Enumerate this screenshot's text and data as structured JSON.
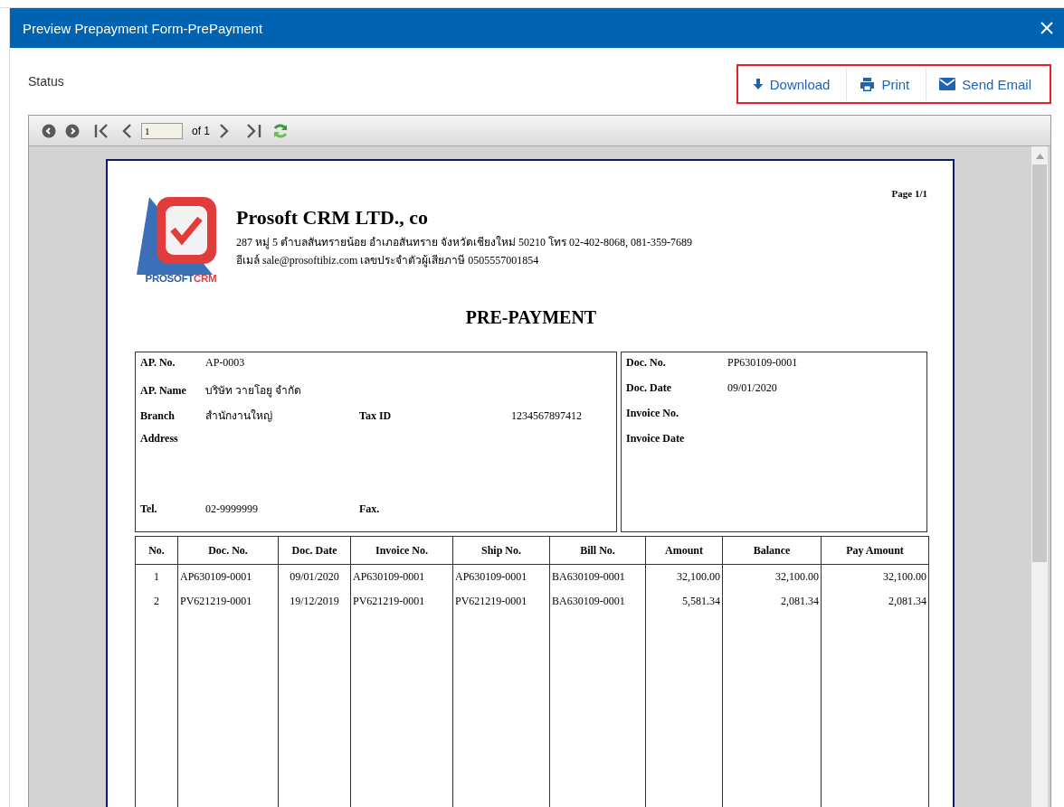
{
  "window": {
    "title": "Preview Prepayment Form-PrePayment"
  },
  "status_label": "Status",
  "actions_highlighted": true,
  "actions": [
    {
      "label": "Download",
      "kind": "download"
    },
    {
      "label": "Print",
      "kind": "print"
    },
    {
      "label": "Send Email",
      "kind": "email"
    }
  ],
  "toolbar": {
    "page_field": "1",
    "page_count": "of 1"
  },
  "report": {
    "page_label": "Page 1/1",
    "logo": {
      "text_1": "PROSOFT",
      "text_2": "CRM"
    },
    "company": "Prosoft CRM LTD., co",
    "address_lines": [
      "287 หมู่ 5 ตำบลสันทรายน้อย อำเภอสันทราย จังหวัดเชียงใหม่ 50210 โทร 02-402-8068, 081-359-7689",
      "อีเมล์ sale@prosoftibiz.com เลขประจำตัวผู้เสียภาษี 0505557001854"
    ],
    "title": "PRE-PAYMENT",
    "left_fields": [
      {
        "label": "AP. No.",
        "value": "AP-0003"
      },
      {
        "label": "AP. Name",
        "value": "บริษัท วายโอยู จำกัด"
      },
      {
        "label": "Branch",
        "value": "สำนักงานใหญ่",
        "label_2": "Tax ID",
        "value_2": "1234567897412"
      },
      {
        "label": "Address"
      },
      {
        "label": "Tel.",
        "value": "02-9999999",
        "label_2": "Fax."
      }
    ],
    "right_fields": [
      {
        "label": "Doc. No.",
        "value": "PP630109-0001"
      },
      {
        "label": "Doc. Date",
        "value": "09/01/2020"
      },
      {
        "label": "Invoice No."
      },
      {
        "label": "Invoice Date"
      }
    ],
    "table": {
      "columns": [
        "No.",
        "Doc. No.",
        "Doc. Date",
        "Invoice No.",
        "Ship No.",
        "Bill No.",
        "Amount",
        "Balance",
        "Pay Amount"
      ],
      "rows": [
        [
          "1",
          "AP630109-0001",
          "09/01/2020",
          "AP630109-0001",
          "AP630109-0001",
          "BA630109-0001",
          "32,100.00",
          "32,100.00",
          "32,100.00"
        ],
        [
          "2",
          "PV621219-0001",
          "19/12/2019",
          "PV621219-0001",
          "PV621219-0001",
          "BA630109-0001",
          "5,581.34",
          "2,081.34",
          "2,081.34"
        ]
      ]
    }
  }
}
